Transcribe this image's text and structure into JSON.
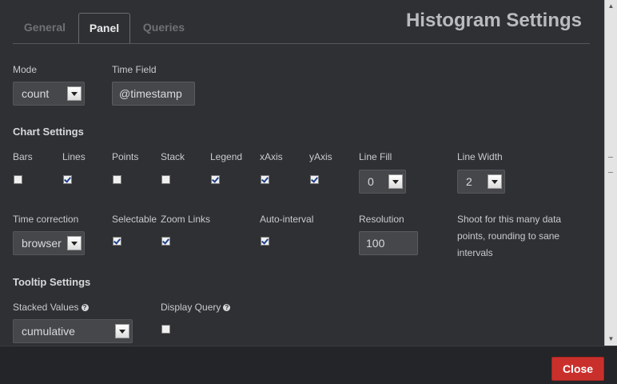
{
  "title": "Histogram Settings",
  "tabs": [
    {
      "label": "General",
      "active": false
    },
    {
      "label": "Panel",
      "active": true
    },
    {
      "label": "Queries",
      "active": false
    }
  ],
  "mode": {
    "label": "Mode",
    "value": "count"
  },
  "time_field": {
    "label": "Time Field",
    "value": "@timestamp"
  },
  "chart_settings": {
    "heading": "Chart Settings",
    "checkboxes": [
      {
        "label": "Bars",
        "checked": false
      },
      {
        "label": "Lines",
        "checked": true
      },
      {
        "label": "Points",
        "checked": false
      },
      {
        "label": "Stack",
        "checked": false
      },
      {
        "label": "Legend",
        "checked": true
      },
      {
        "label": "xAxis",
        "checked": true
      },
      {
        "label": "yAxis",
        "checked": true
      }
    ],
    "line_fill": {
      "label": "Line Fill",
      "value": "0"
    },
    "line_width": {
      "label": "Line Width",
      "value": "2"
    }
  },
  "time_correction": {
    "label": "Time correction",
    "value": "browser"
  },
  "selectable": {
    "label": "Selectable",
    "checked": true
  },
  "zoom_links": {
    "label": "Zoom Links",
    "checked": true
  },
  "auto_interval": {
    "label": "Auto-interval",
    "checked": true
  },
  "resolution": {
    "label": "Resolution",
    "value": "100",
    "note": "Shoot for this many data points, rounding to sane intervals"
  },
  "tooltip_settings": {
    "heading": "Tooltip Settings",
    "stacked_values": {
      "label": "Stacked Values",
      "value": "cumulative"
    },
    "display_query": {
      "label": "Display Query",
      "checked": false
    }
  },
  "footer": {
    "close_label": "Close"
  },
  "icons": {
    "help": "question-circle-icon"
  },
  "colors": {
    "close_button": "#c9302c",
    "background": "#2f3033"
  }
}
